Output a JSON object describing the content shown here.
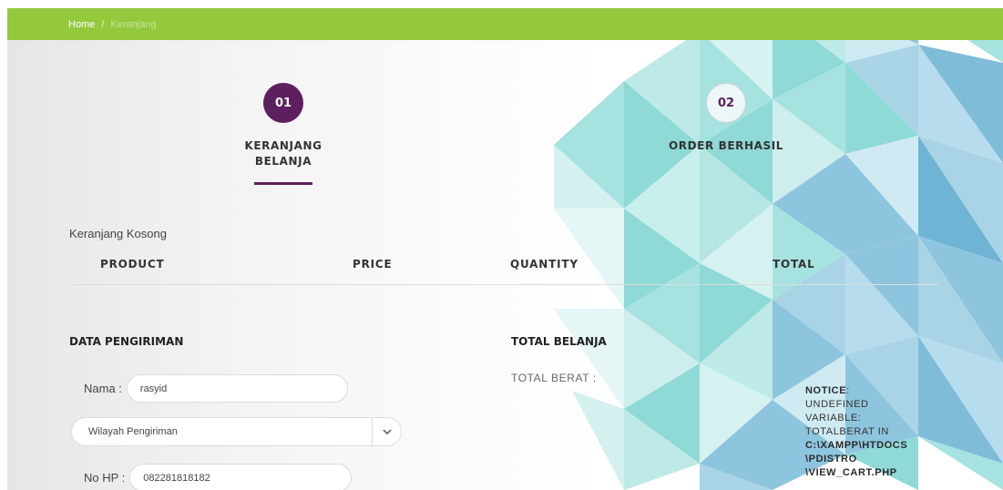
{
  "breadcrumb": {
    "home": "Home",
    "separator": "/",
    "current": "Keranjang"
  },
  "steps": [
    {
      "number": "01",
      "label_line1": "KERANJANG",
      "label_line2": "BELANJA",
      "active": true
    },
    {
      "number": "02",
      "label_line1": "ORDER BERHASIL",
      "active": false
    }
  ],
  "cart": {
    "empty_message": "Keranjang Kosong",
    "columns": [
      "PRODUCT",
      "PRICE",
      "QUANTITY",
      "TOTAL"
    ]
  },
  "shipping": {
    "title": "DATA PENGIRIMAN",
    "name_label": "Nama :",
    "name_value": "rasyid",
    "region_select": "Wilayah Pengiriman",
    "phone_label": "No HP :",
    "phone_value": "082281818182"
  },
  "summary": {
    "title": "TOTAL BELANJA",
    "weight_label": "TOTAL BERAT :"
  },
  "notice": {
    "label": "NOTICE",
    "message_line1": "UNDEFINED",
    "message_line2": "VARIABLE:",
    "message_line3": "TOTALBERAT IN",
    "path_line1": "C:\\XAMPP\\HTDOCS",
    "path_line2": "\\PDISTRO",
    "path_line3": "\\VIEW_CART.PHP"
  },
  "colors": {
    "accent_green": "#95c93d",
    "accent_purple": "#5e1f5f",
    "teal": "#8fd9d6",
    "blue": "#8ec5de"
  },
  "icons": {
    "select_arrow": "chevron-down-icon"
  }
}
